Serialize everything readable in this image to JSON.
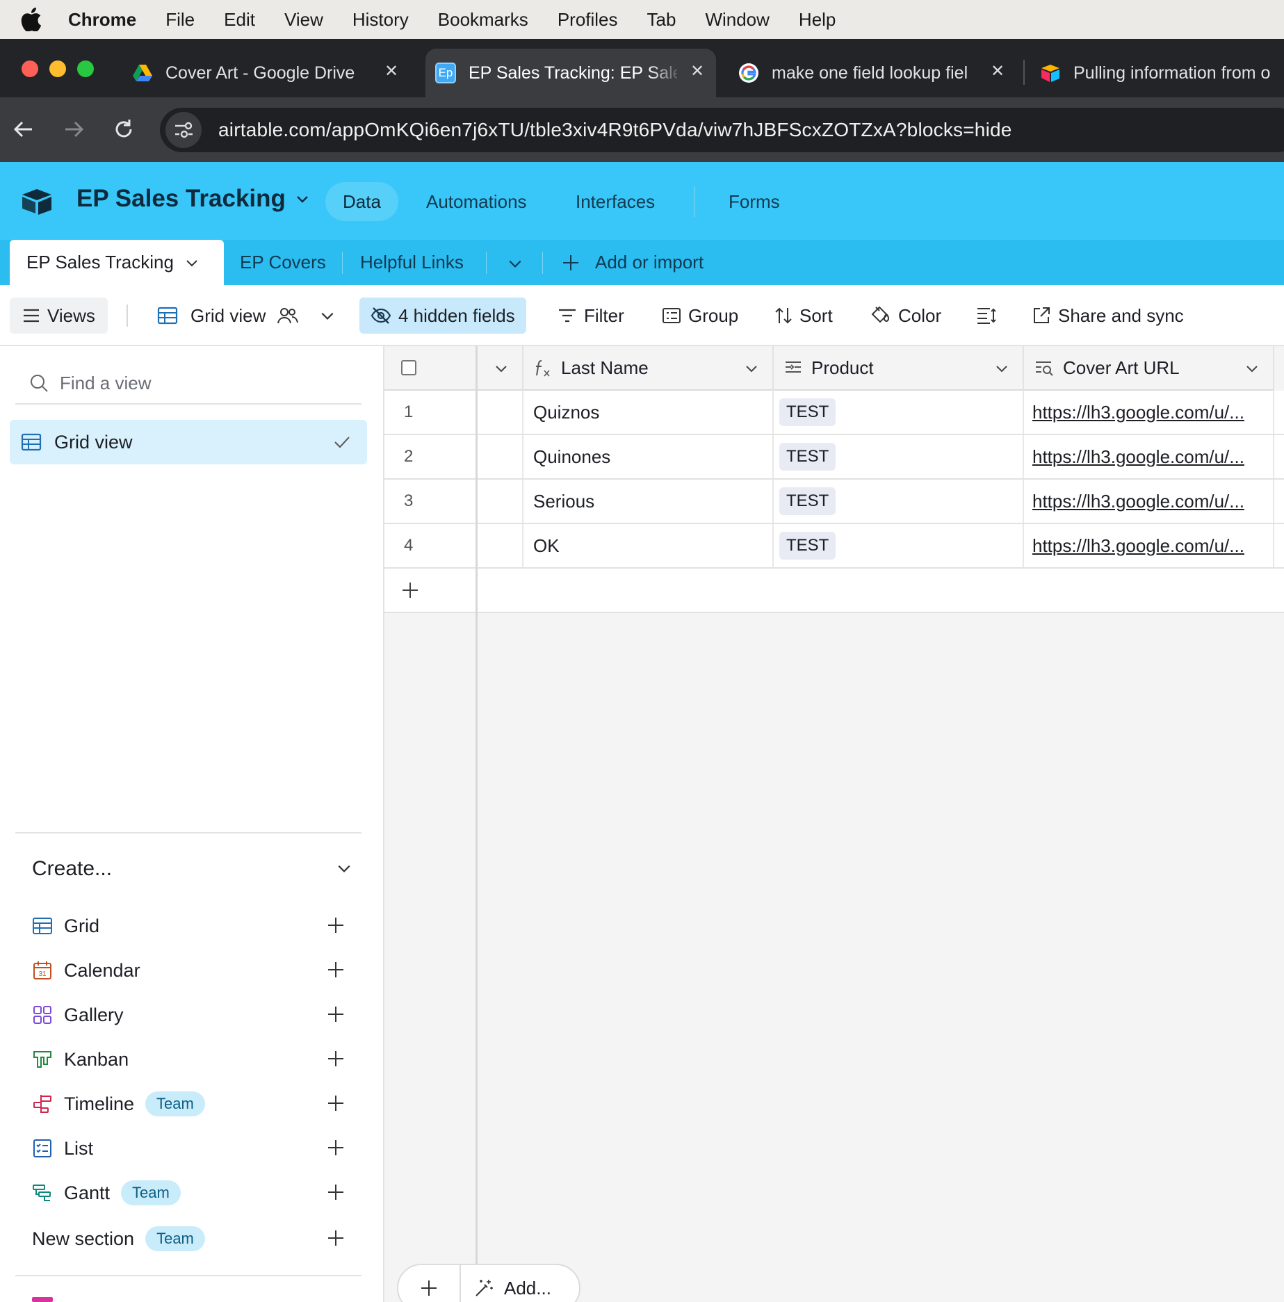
{
  "menubar": {
    "app": "Chrome",
    "items": [
      "File",
      "Edit",
      "View",
      "History",
      "Bookmarks",
      "Profiles",
      "Tab",
      "Window",
      "Help"
    ]
  },
  "browser": {
    "tabs": [
      {
        "title": "Cover Art - Google Drive",
        "icon": "google-drive-icon"
      },
      {
        "title": "EP Sales Tracking: EP Sale",
        "icon": "ep-favicon",
        "favicon_text": "Ep",
        "active": true
      },
      {
        "title": "make one field lookup fiel",
        "icon": "google-icon"
      },
      {
        "title": "Pulling information from o",
        "icon": "airtable-icon"
      }
    ],
    "url": "airtable.com/appOmKQi6en7j6xTU/tble3xiv4R9t6PVda/viw7hJBFScxZOTZxA?blocks=hide"
  },
  "app": {
    "base_name": "EP Sales Tracking",
    "nav": [
      "Data",
      "Automations",
      "Interfaces",
      "Forms"
    ],
    "accent": "#39c7f9"
  },
  "tables": {
    "active": "EP Sales Tracking",
    "others": [
      "EP Covers",
      "Helpful Links"
    ],
    "add_label": "Add or import"
  },
  "toolbar": {
    "views": "Views",
    "view_name": "Grid view",
    "hidden_fields": "4 hidden fields",
    "filter": "Filter",
    "group": "Group",
    "sort": "Sort",
    "color": "Color",
    "share": "Share and sync"
  },
  "sidebar": {
    "search_placeholder": "Find a view",
    "active_view": "Grid view",
    "create_label": "Create...",
    "create_items": [
      {
        "label": "Grid",
        "icon": "grid-icon"
      },
      {
        "label": "Calendar",
        "icon": "calendar-icon"
      },
      {
        "label": "Gallery",
        "icon": "gallery-icon"
      },
      {
        "label": "Kanban",
        "icon": "kanban-icon"
      },
      {
        "label": "Timeline",
        "icon": "timeline-icon",
        "badge": "Team"
      },
      {
        "label": "List",
        "icon": "list-icon"
      },
      {
        "label": "Gantt",
        "icon": "gantt-icon",
        "badge": "Team"
      },
      {
        "label": "New section",
        "badge": "Team"
      }
    ]
  },
  "grid": {
    "columns": [
      "Last Name",
      "Product",
      "Cover Art URL"
    ],
    "rows": [
      {
        "num": "1",
        "last_name": "Quiznos",
        "product": "TEST",
        "url": "https://lh3.google.com/u/..."
      },
      {
        "num": "2",
        "last_name": "Quinones",
        "product": "TEST",
        "url": "https://lh3.google.com/u/..."
      },
      {
        "num": "3",
        "last_name": "Serious",
        "product": "TEST",
        "url": "https://lh3.google.com/u/..."
      },
      {
        "num": "4",
        "last_name": "OK",
        "product": "TEST",
        "url": "https://lh3.google.com/u/..."
      }
    ],
    "add_label": "Add..."
  }
}
